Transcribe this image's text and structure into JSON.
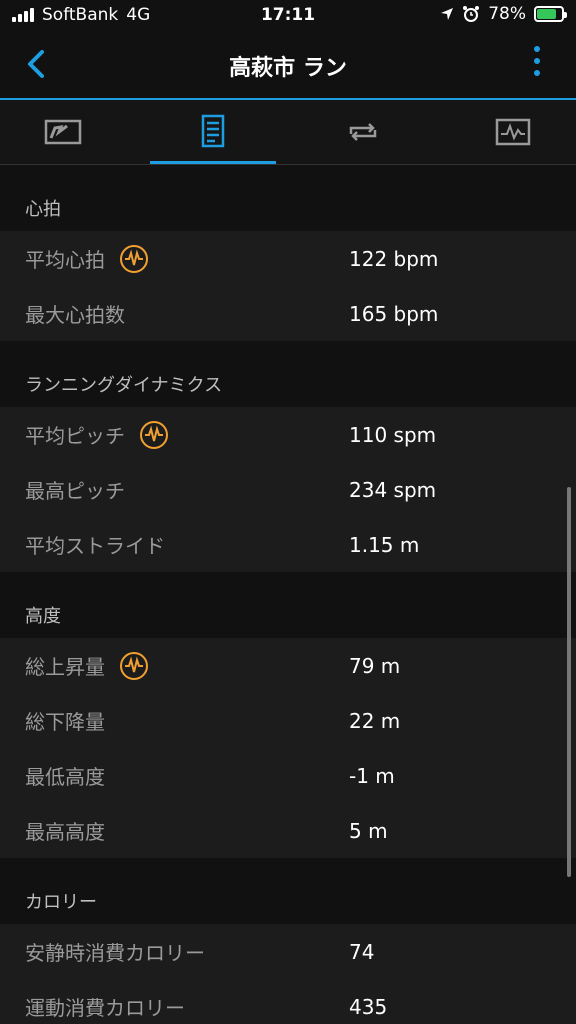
{
  "status_bar": {
    "carrier": "SoftBank",
    "network": "4G",
    "time": "17:11",
    "battery": "78%"
  },
  "nav": {
    "title": "高萩市 ラン"
  },
  "tabs": [
    {
      "name": "map",
      "icon": "map-icon"
    },
    {
      "name": "details",
      "icon": "details-list-icon",
      "active": true
    },
    {
      "name": "laps",
      "icon": "laps-icon"
    },
    {
      "name": "charts",
      "icon": "chart-icon"
    }
  ],
  "sections": [
    {
      "title": "心拍",
      "rows": [
        {
          "label": "平均心拍",
          "value": "122 bpm",
          "icon": true
        },
        {
          "label": "最大心拍数",
          "value": "165 bpm"
        }
      ]
    },
    {
      "title": "ランニングダイナミクス",
      "rows": [
        {
          "label": "平均ピッチ",
          "value": "110 spm",
          "icon": true
        },
        {
          "label": "最高ピッチ",
          "value": "234 spm"
        },
        {
          "label": "平均ストライド",
          "value": "1.15 m"
        }
      ]
    },
    {
      "title": "高度",
      "rows": [
        {
          "label": "総上昇量",
          "value": "79 m",
          "icon": true
        },
        {
          "label": "総下降量",
          "value": "22 m"
        },
        {
          "label": "最低高度",
          "value": "-1 m"
        },
        {
          "label": "最高高度",
          "value": "5 m"
        }
      ]
    },
    {
      "title": "カロリー",
      "rows": [
        {
          "label": "安静時消費カロリー",
          "value": "74"
        },
        {
          "label": "運動消費カロリー",
          "value": "435"
        }
      ]
    }
  ],
  "colors": {
    "accent": "#1e9ee0",
    "orange": "#f0a030"
  }
}
